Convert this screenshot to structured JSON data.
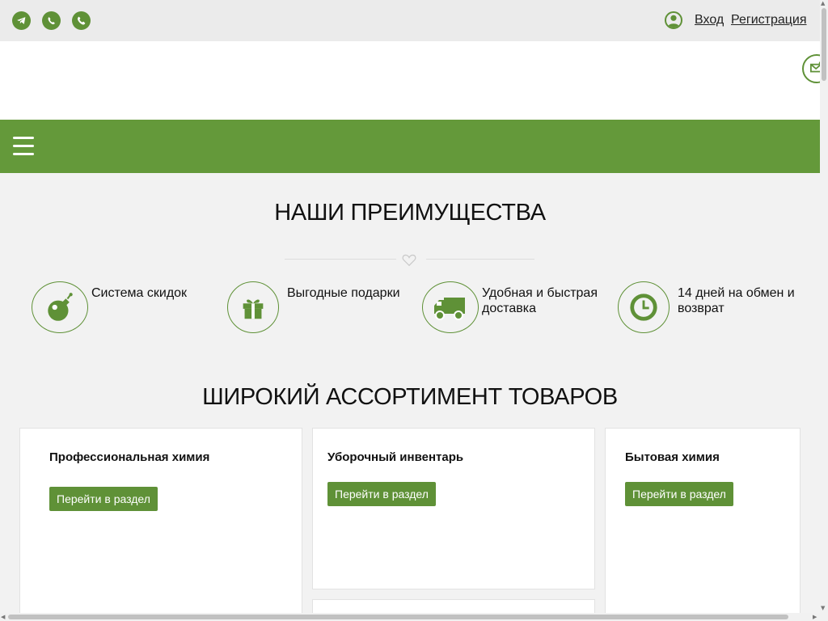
{
  "topbar": {
    "contacts": [
      {
        "icon": "telegram-icon"
      },
      {
        "icon": "whatsapp-icon"
      },
      {
        "icon": "phone-icon"
      }
    ],
    "login": "Вход",
    "register": "Регистрация"
  },
  "advantages": {
    "title": "НАШИ ПРЕИМУЩЕСТВА",
    "items": [
      {
        "label": "Система скидок",
        "icon": "bomb-icon"
      },
      {
        "label": "Выгодные подарки",
        "icon": "gift-icon"
      },
      {
        "label": "Удобная и быстрая доставка",
        "icon": "truck-icon"
      },
      {
        "label": "14 дней на обмен и возврат",
        "icon": "clock-icon"
      }
    ]
  },
  "assortment": {
    "title": "ШИРОКИЙ АССОРТИМЕНТ ТОВАРОВ",
    "cards": [
      {
        "title": "Профессиональная химия",
        "button": "Перейти в раздел"
      },
      {
        "title": "Уборочный инвентарь",
        "button": "Перейти в раздел"
      },
      {
        "title": "Бытовая химия",
        "button": "Перейти в раздел"
      }
    ]
  },
  "colors": {
    "accent": "#64993a",
    "accent_dark": "#5f9137",
    "background": "#f2f2f2"
  }
}
